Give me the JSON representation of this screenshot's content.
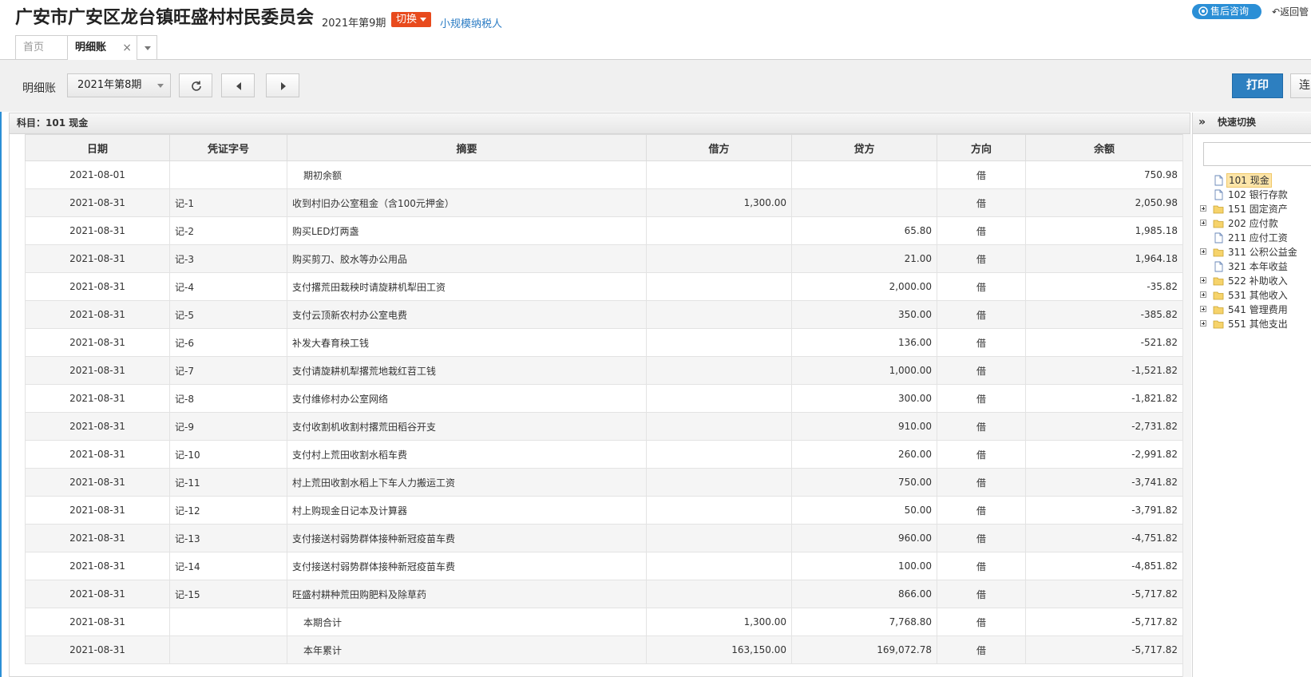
{
  "header": {
    "org_title": "广安市广安区龙台镇旺盛村村民委员会",
    "current_period": "2021年第9期",
    "switch_label": "切换",
    "taxpayer_type": "小规模纳税人",
    "support_label": "售后咨询",
    "back_label": "返回管"
  },
  "tabs": {
    "home": "首页",
    "active": "明细账",
    "close": "×"
  },
  "toolbar": {
    "label": "明细账",
    "period_value": "2021年第8期",
    "print_label": "打印",
    "connect_label": "连"
  },
  "ledger": {
    "subject": "科目：101  现金",
    "columns": [
      "日期",
      "凭证字号",
      "摘要",
      "借方",
      "贷方",
      "方向",
      "余额"
    ],
    "rows": [
      {
        "date": "2021-08-01",
        "voucher": "",
        "summary": "期初余额",
        "debit": "",
        "credit": "",
        "dir": "借",
        "balance": "750.98",
        "indent": true
      },
      {
        "date": "2021-08-31",
        "voucher": "记-1",
        "summary": "收到村旧办公室租金（含100元押金）",
        "debit": "1,300.00",
        "credit": "",
        "dir": "借",
        "balance": "2,050.98"
      },
      {
        "date": "2021-08-31",
        "voucher": "记-2",
        "summary": "购买LED灯两盏",
        "debit": "",
        "credit": "65.80",
        "dir": "借",
        "balance": "1,985.18"
      },
      {
        "date": "2021-08-31",
        "voucher": "记-3",
        "summary": "购买剪刀、胶水等办公用品",
        "debit": "",
        "credit": "21.00",
        "dir": "借",
        "balance": "1,964.18"
      },
      {
        "date": "2021-08-31",
        "voucher": "记-4",
        "summary": "支付撂荒田栽秧时请旋耕机犁田工资",
        "debit": "",
        "credit": "2,000.00",
        "dir": "借",
        "balance": "-35.82"
      },
      {
        "date": "2021-08-31",
        "voucher": "记-5",
        "summary": "支付云顶新农村办公室电费",
        "debit": "",
        "credit": "350.00",
        "dir": "借",
        "balance": "-385.82"
      },
      {
        "date": "2021-08-31",
        "voucher": "记-6",
        "summary": "补发大春育秧工钱",
        "debit": "",
        "credit": "136.00",
        "dir": "借",
        "balance": "-521.82"
      },
      {
        "date": "2021-08-31",
        "voucher": "记-7",
        "summary": "支付请旋耕机犁撂荒地栽红苕工钱",
        "debit": "",
        "credit": "1,000.00",
        "dir": "借",
        "balance": "-1,521.82"
      },
      {
        "date": "2021-08-31",
        "voucher": "记-8",
        "summary": "支付维修村办公室网络",
        "debit": "",
        "credit": "300.00",
        "dir": "借",
        "balance": "-1,821.82"
      },
      {
        "date": "2021-08-31",
        "voucher": "记-9",
        "summary": "支付收割机收割村撂荒田稻谷开支",
        "debit": "",
        "credit": "910.00",
        "dir": "借",
        "balance": "-2,731.82"
      },
      {
        "date": "2021-08-31",
        "voucher": "记-10",
        "summary": "支付村上荒田收割水稻车费",
        "debit": "",
        "credit": "260.00",
        "dir": "借",
        "balance": "-2,991.82"
      },
      {
        "date": "2021-08-31",
        "voucher": "记-11",
        "summary": "村上荒田收割水稻上下车人力搬运工资",
        "debit": "",
        "credit": "750.00",
        "dir": "借",
        "balance": "-3,741.82"
      },
      {
        "date": "2021-08-31",
        "voucher": "记-12",
        "summary": "村上购现金日记本及计算器",
        "debit": "",
        "credit": "50.00",
        "dir": "借",
        "balance": "-3,791.82"
      },
      {
        "date": "2021-08-31",
        "voucher": "记-13",
        "summary": "支付接送村弱势群体接种新冠疫苗车费",
        "debit": "",
        "credit": "960.00",
        "dir": "借",
        "balance": "-4,751.82"
      },
      {
        "date": "2021-08-31",
        "voucher": "记-14",
        "summary": "支付接送村弱势群体接种新冠疫苗车费",
        "debit": "",
        "credit": "100.00",
        "dir": "借",
        "balance": "-4,851.82"
      },
      {
        "date": "2021-08-31",
        "voucher": "记-15",
        "summary": "旺盛村耕种荒田购肥料及除草药",
        "debit": "",
        "credit": "866.00",
        "dir": "借",
        "balance": "-5,717.82"
      },
      {
        "date": "2021-08-31",
        "voucher": "",
        "summary": "本期合计",
        "debit": "1,300.00",
        "credit": "7,768.80",
        "dir": "借",
        "balance": "-5,717.82",
        "indent": true
      },
      {
        "date": "2021-08-31",
        "voucher": "",
        "summary": "本年累计",
        "debit": "163,150.00",
        "credit": "169,072.78",
        "dir": "借",
        "balance": "-5,717.82",
        "indent": true
      }
    ]
  },
  "quick_switch": {
    "title": "快速切换",
    "search_value": "",
    "items": [
      {
        "label": "101 现金",
        "type": "file",
        "expandable": false,
        "selected": true
      },
      {
        "label": "102 银行存款",
        "type": "file",
        "expandable": false
      },
      {
        "label": "151 固定资产",
        "type": "folder",
        "expandable": true
      },
      {
        "label": "202 应付款",
        "type": "folder",
        "expandable": true
      },
      {
        "label": "211 应付工资",
        "type": "file",
        "expandable": false
      },
      {
        "label": "311 公积公益金",
        "type": "folder",
        "expandable": true
      },
      {
        "label": "321 本年收益",
        "type": "file",
        "expandable": false
      },
      {
        "label": "522 补助收入",
        "type": "folder",
        "expandable": true
      },
      {
        "label": "531 其他收入",
        "type": "folder",
        "expandable": true
      },
      {
        "label": "541 管理费用",
        "type": "folder",
        "expandable": true
      },
      {
        "label": "551 其他支出",
        "type": "folder",
        "expandable": true
      }
    ]
  },
  "colors": {
    "accent": "#2b8fd6",
    "switch": "#e84a1d",
    "print": "#2d7fc0",
    "link": "#2b7cc4"
  }
}
